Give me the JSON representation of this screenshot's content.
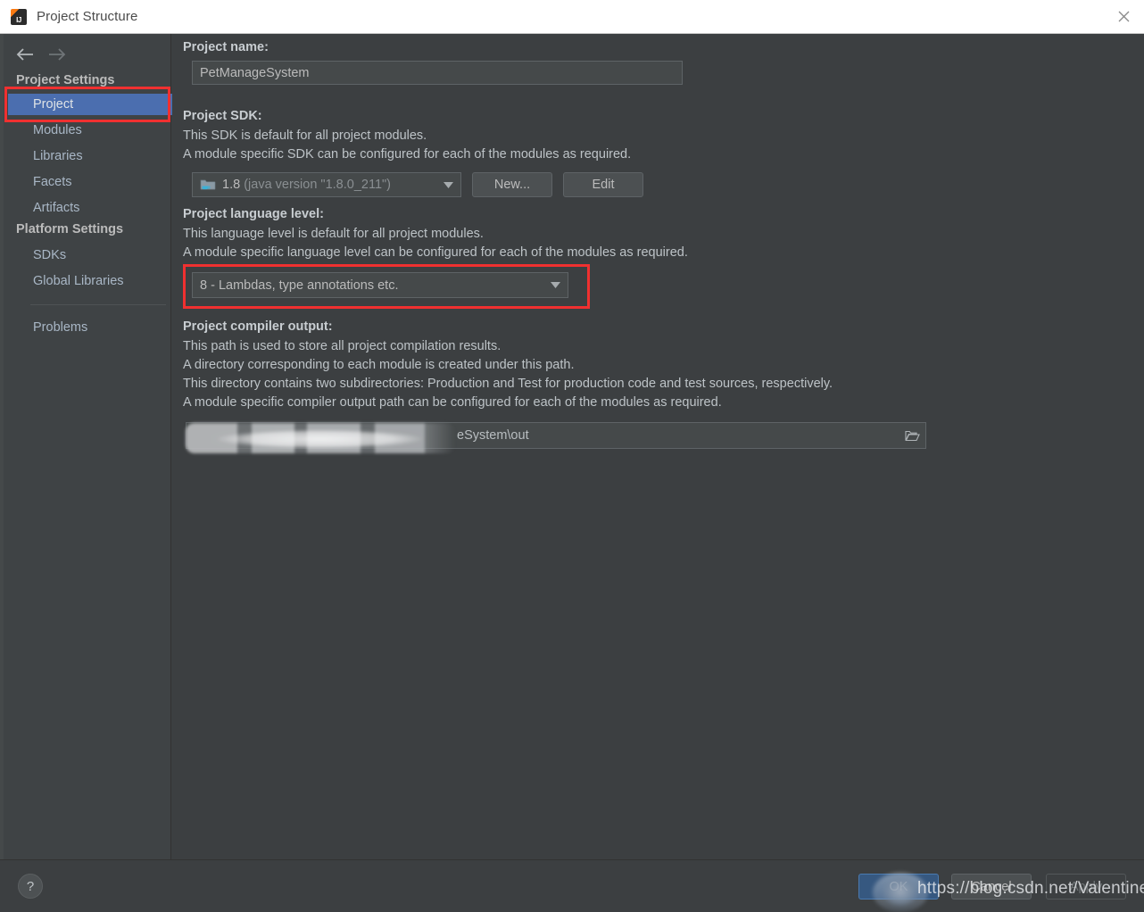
{
  "window": {
    "title": "Project Structure",
    "app_icon": "intellij-idea-icon",
    "close_icon": "close-icon"
  },
  "nav": {
    "back_icon": "arrow-left-icon",
    "forward_icon": "arrow-right-icon"
  },
  "sidebar": {
    "groups": [
      {
        "label": "Project Settings",
        "items": [
          {
            "label": "Project",
            "selected": true
          },
          {
            "label": "Modules",
            "selected": false
          },
          {
            "label": "Libraries",
            "selected": false
          },
          {
            "label": "Facets",
            "selected": false
          },
          {
            "label": "Artifacts",
            "selected": false
          }
        ]
      },
      {
        "label": "Platform Settings",
        "items": [
          {
            "label": "SDKs",
            "selected": false
          },
          {
            "label": "Global Libraries",
            "selected": false
          }
        ]
      }
    ],
    "problems": {
      "label": "Problems"
    }
  },
  "main": {
    "project_name": {
      "title": "Project name:",
      "value": "PetManageSystem"
    },
    "project_sdk": {
      "title": "Project SDK:",
      "desc": [
        "This SDK is default for all project modules.",
        "A module specific SDK can be configured for each of the modules as required."
      ],
      "selected_name": "1.8",
      "selected_detail": "(java version \"1.8.0_211\")",
      "icon": "java-sdk-folder-icon",
      "dropdown_icon": "chevron-down-icon",
      "new_button": "New...",
      "edit_button": "Edit"
    },
    "language_level": {
      "title": "Project language level:",
      "desc": [
        "This language level is default for all project modules.",
        "A module specific language level can be configured for each of the modules as required."
      ],
      "selected": "8 - Lambdas, type annotations etc.",
      "dropdown_icon": "chevron-down-icon"
    },
    "compiler_output": {
      "title": "Project compiler output:",
      "desc": [
        "This path is used to store all project compilation results.",
        "A directory corresponding to each module is created under this path.",
        "This directory contains two subdirectories: Production and Test for production code and test sources, respectively.",
        "A module specific compiler output path can be configured for each of the modules as required."
      ],
      "path_value": "eSystem\\out",
      "browse_icon": "folder-open-icon"
    }
  },
  "footer": {
    "help_label": "?",
    "help_icon": "question-mark-icon",
    "ok_label": "OK",
    "cancel_label": "Cancel",
    "apply_label": "Apply"
  },
  "watermark": {
    "text": "https://blog.csdn.net/Valentine_T"
  },
  "colors": {
    "accent_selection": "#4b6eaf",
    "ok_button": "#365880",
    "annotation_red": "#f03030",
    "panel_bg": "#3c3f41",
    "sidebar_bg": "#3f4345",
    "field_bg": "#45494a",
    "text": "#bdc3c7",
    "titlebar_bg": "#ffffff"
  },
  "annotations": [
    {
      "name": "project-item-highlight"
    },
    {
      "name": "language-level-highlight"
    }
  ]
}
